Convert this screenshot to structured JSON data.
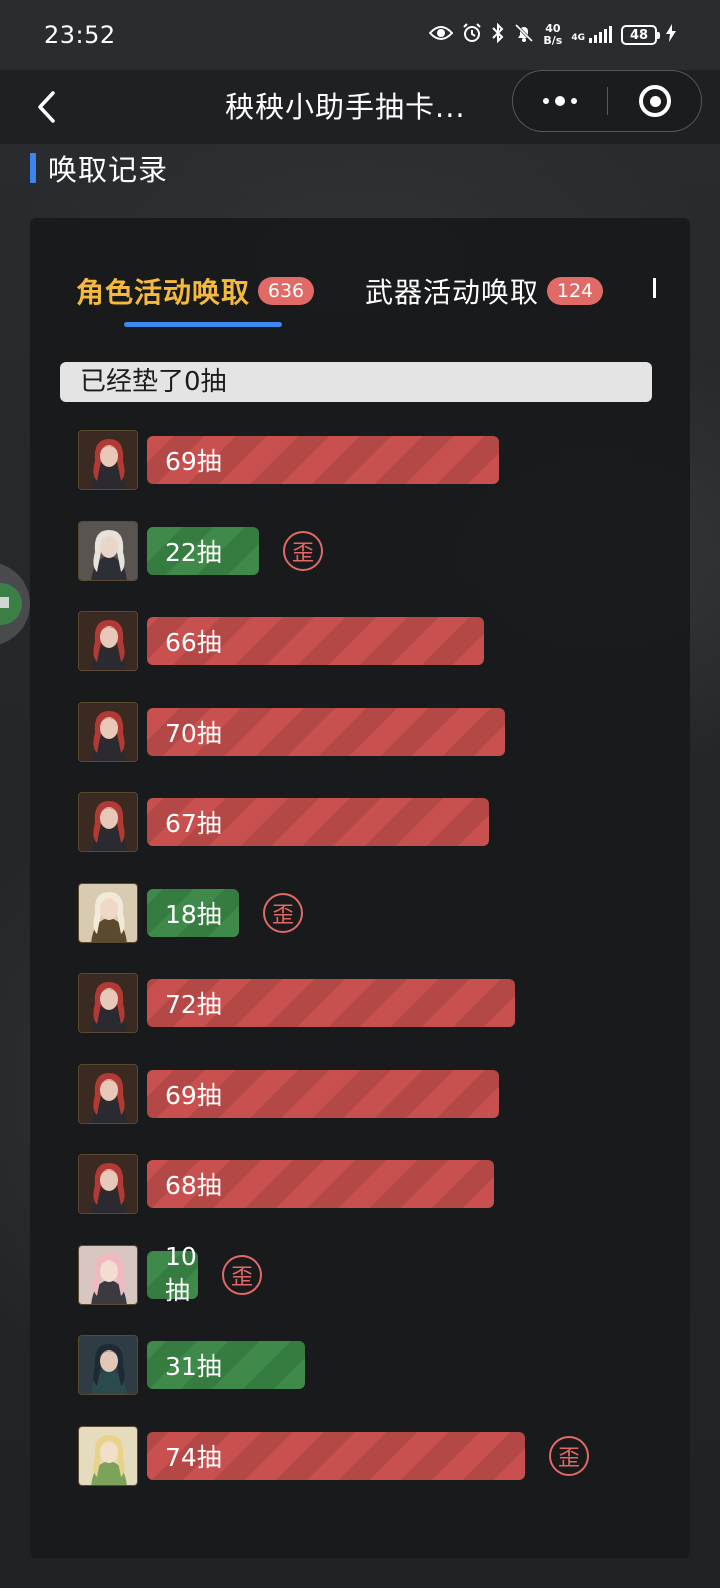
{
  "status": {
    "time": "23:52",
    "net_speed_value": "40",
    "net_speed_unit": "B/s",
    "network": "4G",
    "battery": "48"
  },
  "nav": {
    "title": "秧秧小助手抽卡..."
  },
  "section": {
    "title": "唤取记录"
  },
  "tabs": [
    {
      "label": "角色活动唤取",
      "count": "636",
      "active": true
    },
    {
      "label": "武器活动唤取",
      "count": "124",
      "active": false
    }
  ],
  "pity": {
    "text": "已经垫了0抽"
  },
  "off_label": "歪",
  "colors": {
    "accent_tab": "#f5b93e",
    "indicator": "#3e86f0",
    "badge": "#e06a66",
    "bar_red": "#c8514f",
    "bar_green": "#3f8a4a"
  },
  "records": [
    {
      "pulls": "69抽",
      "value": 69,
      "status": "red",
      "avatar": "red-hair-character",
      "off_banner": false
    },
    {
      "pulls": "22抽",
      "value": 22,
      "status": "green",
      "avatar": "white-hair-character",
      "off_banner": true
    },
    {
      "pulls": "66抽",
      "value": 66,
      "status": "red",
      "avatar": "red-hair-character",
      "off_banner": false
    },
    {
      "pulls": "70抽",
      "value": 70,
      "status": "red",
      "avatar": "red-hair-character",
      "off_banner": false
    },
    {
      "pulls": "67抽",
      "value": 67,
      "status": "red",
      "avatar": "red-hair-character",
      "off_banner": false
    },
    {
      "pulls": "18抽",
      "value": 18,
      "status": "green",
      "avatar": "blonde-character",
      "off_banner": true
    },
    {
      "pulls": "72抽",
      "value": 72,
      "status": "red",
      "avatar": "red-hair-character",
      "off_banner": false
    },
    {
      "pulls": "69抽",
      "value": 69,
      "status": "red",
      "avatar": "red-hair-character",
      "off_banner": false
    },
    {
      "pulls": "68抽",
      "value": 68,
      "status": "red",
      "avatar": "red-hair-character",
      "off_banner": false
    },
    {
      "pulls": "10抽",
      "value": 10,
      "status": "green",
      "avatar": "pink-hair-character",
      "off_banner": true
    },
    {
      "pulls": "31抽",
      "value": 31,
      "status": "green",
      "avatar": "dark-hair-character",
      "off_banner": false
    },
    {
      "pulls": "74抽",
      "value": 74,
      "status": "red",
      "avatar": "green-dress-character",
      "off_banner": true
    }
  ]
}
